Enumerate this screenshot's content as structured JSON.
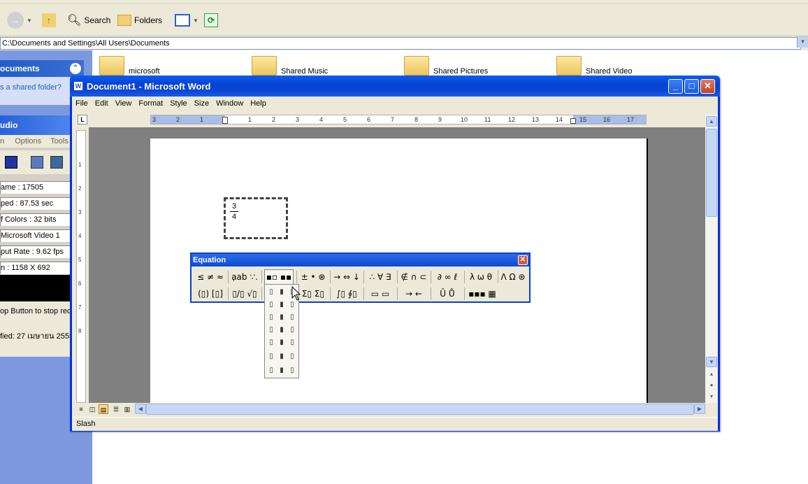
{
  "explorer": {
    "toolbar": {
      "search": "Search",
      "folders": "Folders"
    },
    "address": "C:\\Documents and Settings\\All Users\\Documents",
    "task_pane": {
      "header": "ocuments",
      "link": "s a shared folder?"
    },
    "folders": [
      "microsoft",
      "Shared Music",
      "Shared Pictures",
      "Shared Video"
    ]
  },
  "recorder": {
    "title": "udio",
    "menu": [
      "n",
      "Options",
      "Tools"
    ],
    "info": [
      "ame : 17505",
      "ped : 87.53 sec",
      "f Colors : 32 bits",
      "Microsoft Video 1",
      "put Rate : 9.62 fps",
      "n : 1158 X 692"
    ],
    "status": [
      "op Button to stop rec",
      "fied: 27 เมษายน 2555"
    ]
  },
  "word": {
    "title": "Document1 - Microsoft Word",
    "icon": "W",
    "menu": [
      "File",
      "Edit",
      "View",
      "Format",
      "Style",
      "Size",
      "Window",
      "Help"
    ],
    "tab_selector": "L",
    "ruler_h": [
      "3",
      "2",
      "1",
      "1",
      "2",
      "3",
      "4",
      "5",
      "6",
      "7",
      "8",
      "9",
      "10",
      "11",
      "12",
      "13",
      "14",
      "15",
      "16",
      "17"
    ],
    "ruler_v": [
      "1",
      "2",
      "3",
      "4",
      "5",
      "6",
      "7",
      "8"
    ],
    "fraction": {
      "numerator": "3",
      "denominator": "4"
    },
    "status": "Slash"
  },
  "equation": {
    "title": "Equation",
    "row1": [
      "≤ ≠ ≈",
      "ạab ∵.",
      "▪▫ ▪▪",
      "± • ⊗",
      "→ ⇔ ↓",
      "∴ ∀ ∃",
      "∉ ∩ ⊂",
      "∂ ∞ ℓ",
      "λ ω θ",
      "Λ Ω ⊛"
    ],
    "row2": [
      "(▯) [▯]",
      "▯/▯ √▯",
      "▯▯ ▯▯",
      "Σ▯ Σ▯",
      "∫▯ ∮▯",
      "▭ ▭",
      "→ ←",
      "Ū Ů",
      "▪▪▪ ▦"
    ],
    "palette": [
      "▯",
      "▮",
      "▯",
      "▯",
      "▮",
      "▯",
      "▯",
      "▮",
      "▯",
      "▯",
      "▮",
      "▯",
      "▯",
      "▮",
      "▯",
      "▯",
      "▮",
      "▯",
      "▯",
      "▮",
      "▯"
    ]
  },
  "colors": {
    "xp_blue": "#0842d0",
    "task_pane": "#7c99e0",
    "close_red": "#c9411e"
  }
}
